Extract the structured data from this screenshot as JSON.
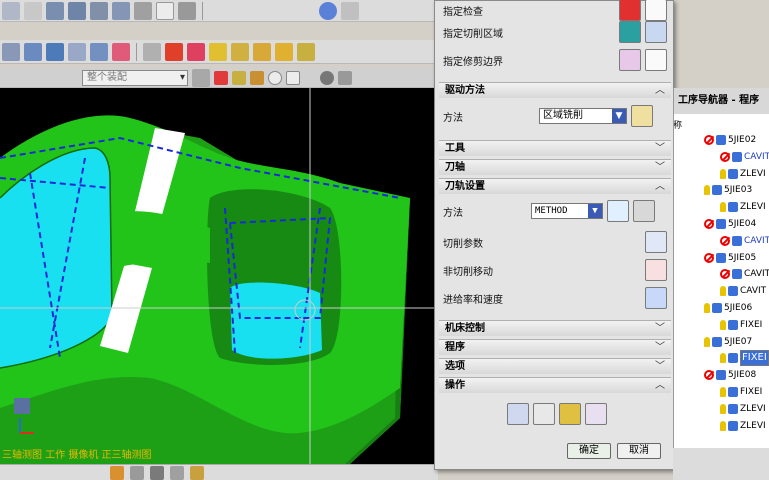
{
  "viewport": {
    "status_text": "三轴测图 工作 摄像机 正三轴测图"
  },
  "toolbar": {
    "filter_placeholder": "整个装配"
  },
  "dialog": {
    "specify_check": "指定检查",
    "specify_cut_area": "指定切削区域",
    "specify_trim_boundary": "指定修剪边界",
    "drive_method_header": "驱动方法",
    "method_label": "方法",
    "drive_method_value": "区域铣削",
    "tool_header": "工具",
    "axis_header": "刀轴",
    "path_settings_header": "刀轨设置",
    "path_method_label": "方法",
    "path_method_value": "METHOD",
    "cut_params": "切削参数",
    "non_cut_moves": "非切削移动",
    "feeds_speeds": "进给率和速度",
    "machine_control_header": "机床控制",
    "program_header": "程序",
    "options_header": "选项",
    "actions_header": "操作",
    "ok": "确定",
    "cancel": "取消"
  },
  "navigator": {
    "title": "工序导航器 - 程序",
    "header_frag": "称",
    "items": [
      {
        "label": "5JIE02",
        "status": "no",
        "style": "normal"
      },
      {
        "label": "CAVIT",
        "status": "no",
        "style": "blue"
      },
      {
        "label": "ZLEVI",
        "status": "check",
        "style": "normal"
      },
      {
        "label": "5JIE03",
        "status": "check",
        "style": "normal"
      },
      {
        "label": "ZLEVI",
        "status": "check",
        "style": "normal"
      },
      {
        "label": "5JIE04",
        "status": "no",
        "style": "normal"
      },
      {
        "label": "CAVIT",
        "status": "no",
        "style": "blue"
      },
      {
        "label": "5JIE05",
        "status": "no",
        "style": "normal"
      },
      {
        "label": "CAVIT",
        "status": "no",
        "style": "normal"
      },
      {
        "label": "CAVIT",
        "status": "check",
        "style": "normal"
      },
      {
        "label": "5JIE06",
        "status": "check",
        "style": "normal"
      },
      {
        "label": "FIXEI",
        "status": "check",
        "style": "normal"
      },
      {
        "label": "5JIE07",
        "status": "check",
        "style": "normal"
      },
      {
        "label": "FIXEI",
        "status": "check",
        "style": "selected"
      },
      {
        "label": "5JIE08",
        "status": "no",
        "style": "normal"
      },
      {
        "label": "FIXEI",
        "status": "check",
        "style": "normal"
      },
      {
        "label": "ZLEVI",
        "status": "check",
        "style": "normal"
      },
      {
        "label": "ZLEVI",
        "status": "check",
        "style": "normal"
      }
    ]
  },
  "colors": {
    "part_green": "#22c41a",
    "cavity_cyan": "#19e0f0",
    "toolpath_blue": "#1a2ad8",
    "accent_red": "#e02020"
  }
}
